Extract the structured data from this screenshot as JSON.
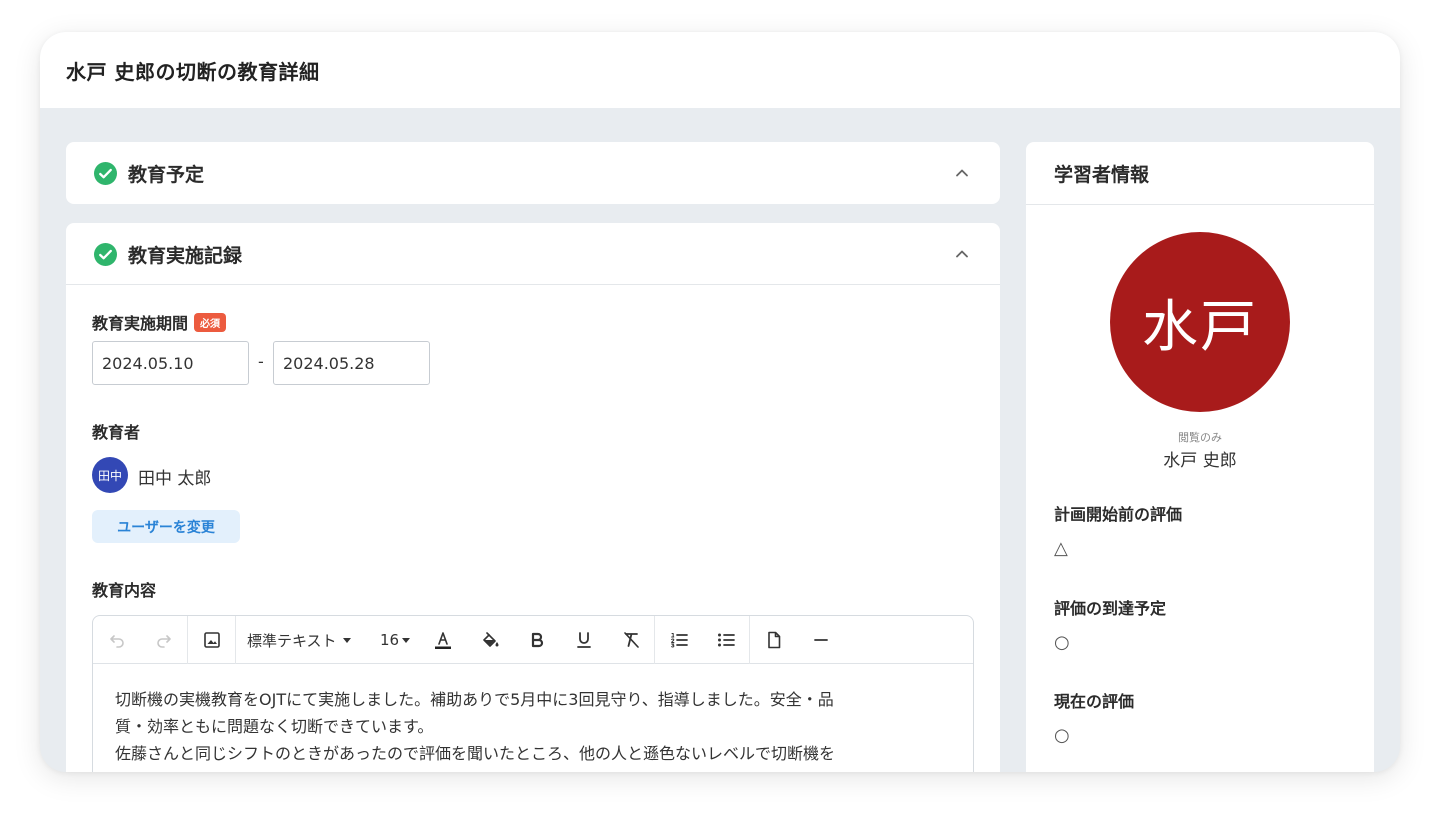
{
  "page": {
    "title": "水戸 史郎の切断の教育詳細"
  },
  "sections": {
    "schedule": {
      "title": "教育予定"
    },
    "record": {
      "title": "教育実施記録"
    }
  },
  "record": {
    "period_label": "教育実施期間",
    "required_badge": "必須",
    "start_date": "2024.05.10",
    "end_date": "2024.05.28",
    "date_separator": "-",
    "educator_label": "教育者",
    "educator": {
      "avatar_text": "田中",
      "name": "田中 太郎"
    },
    "change_user_button": "ユーザーを変更",
    "content_label": "教育内容",
    "toolbar": {
      "text_style": "標準テキスト",
      "font_size": "16"
    },
    "content_text": "切断機の実機教育をOJTにて実施しました。補助ありで5月中に3回見守り、指導しました。安全・品\n質・効率ともに問題なく切断できています。\n佐藤さんと同じシフトのときがあったので評価を聞いたところ、他の人と遜色ないレベルで切断機を"
  },
  "learner": {
    "title": "学習者情報",
    "avatar_text": "水戸",
    "view_only": "閲覧のみ",
    "name": "水戸 史郎",
    "eval_before_label": "計画開始前の評価",
    "eval_before_value": "△",
    "eval_target_label": "評価の到達予定",
    "eval_target_value": "○",
    "eval_current_label": "現在の評価",
    "eval_current_value": "○"
  },
  "colors": {
    "check_green": "#2fb56c",
    "avatar_large": "#a81b1b",
    "avatar_small": "#3348b5",
    "required_badge": "#ec5b3f",
    "link_blue": "#2a83d6",
    "background": "#e8ecf0"
  },
  "icons": [
    "check-circle-icon",
    "chevron-up-icon",
    "undo-icon",
    "redo-icon",
    "image-icon",
    "text-color-icon",
    "fill-color-icon",
    "bold-icon",
    "underline-icon",
    "clear-format-icon",
    "numbered-list-icon",
    "bullet-list-icon",
    "document-icon",
    "horizontal-rule-icon"
  ]
}
